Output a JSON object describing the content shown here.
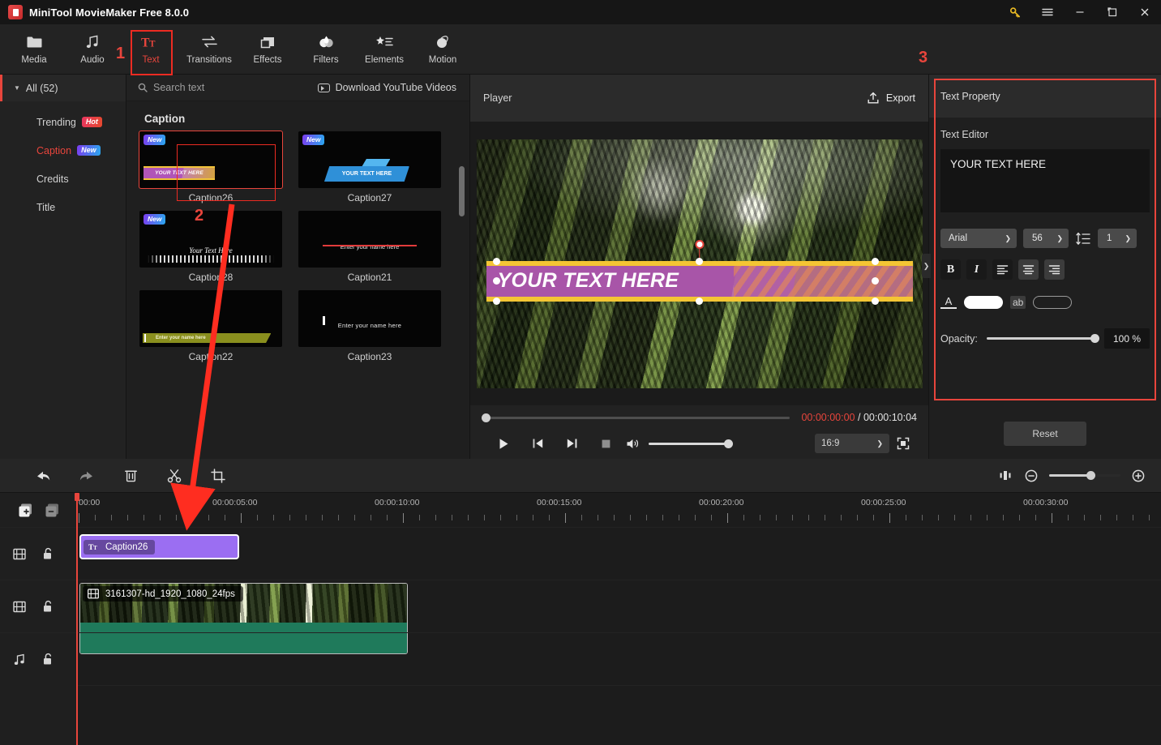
{
  "window": {
    "title": "MiniTool MovieMaker Free 8.0.0",
    "controls": {
      "key": "key-icon",
      "menu": "hamburger-icon",
      "minimize": "–",
      "maximize": "❐",
      "close": "✕"
    }
  },
  "toolbar": {
    "tabs": [
      {
        "label": "Media",
        "icon": "folder-icon",
        "active": false
      },
      {
        "label": "Audio",
        "icon": "music-note-icon",
        "active": false
      },
      {
        "label": "Text",
        "icon": "text-tt-icon",
        "active": true
      },
      {
        "label": "Transitions",
        "icon": "transitions-arrows-icon",
        "active": false
      },
      {
        "label": "Effects",
        "icon": "effects-squares-icon",
        "active": false
      },
      {
        "label": "Filters",
        "icon": "filters-drop-icon",
        "active": false
      },
      {
        "label": "Elements",
        "icon": "elements-star-icon",
        "active": false
      },
      {
        "label": "Motion",
        "icon": "motion-ball-icon",
        "active": false
      }
    ]
  },
  "sidebar": {
    "all": {
      "label": "All (52)",
      "caret": "▼"
    },
    "items": [
      {
        "label": "Trending",
        "badge": "Hot",
        "badge_type": "hot",
        "selected": false
      },
      {
        "label": "Caption",
        "badge": "New",
        "badge_type": "new",
        "selected": true
      },
      {
        "label": "Credits",
        "badge": "",
        "badge_type": "",
        "selected": false
      },
      {
        "label": "Title",
        "badge": "",
        "badge_type": "",
        "selected": false
      }
    ]
  },
  "browse": {
    "search_placeholder": "Search text",
    "search_value": "",
    "download_label": "Download YouTube Videos",
    "section_title": "Caption",
    "tiles": [
      {
        "label": "Caption26",
        "badge": "New",
        "selected": true,
        "art": "art26",
        "art_text": "YOUR TEXT HERE"
      },
      {
        "label": "Caption27",
        "badge": "New",
        "selected": false,
        "art": "art27",
        "art_text": "YOUR TEXT HERE"
      },
      {
        "label": "Caption28",
        "badge": "New",
        "selected": false,
        "art": "art28",
        "art_text": "Your Text Here"
      },
      {
        "label": "Caption21",
        "badge": "",
        "selected": false,
        "art": "art21",
        "art_text": "Enter your name here"
      },
      {
        "label": "Caption22",
        "badge": "",
        "selected": false,
        "art": "art22",
        "art_text": "Enter your name here"
      },
      {
        "label": "Caption23",
        "badge": "",
        "selected": false,
        "art": "art23",
        "art_text": "Enter your name here"
      }
    ]
  },
  "player": {
    "title": "Player",
    "export_label": "Export",
    "overlay_text": "YOUR TEXT HERE",
    "current_time": "00:00:00:00",
    "separator": "/",
    "total_time": "00:00:10:04",
    "aspect_ratio": "16:9",
    "buttons": {
      "play": "▶",
      "prev_frame": "|◀",
      "next_frame": "▶|",
      "stop": "■",
      "volume": "volume-icon",
      "fullscreen": "fullscreen-icon"
    }
  },
  "text_property": {
    "panel_title": "Text Property",
    "editor_label": "Text Editor",
    "editor_value": "YOUR TEXT HERE",
    "font_family": "Arial",
    "font_size": "56",
    "line_height": "1",
    "bold": "B",
    "italic": "I",
    "align_left": "align-left-icon",
    "align_center": "align-center-icon",
    "align_right": "align-right-icon",
    "fill_color": "#ffffff",
    "outline_color": "transparent",
    "opacity_label": "Opacity:",
    "opacity_value": "100 %",
    "reset_label": "Reset"
  },
  "timeline": {
    "tools": [
      {
        "name": "undo",
        "icon": "undo-arrow-icon",
        "dim": false
      },
      {
        "name": "redo",
        "icon": "redo-arrow-icon",
        "dim": true
      },
      {
        "name": "delete",
        "icon": "trash-icon",
        "dim": false
      },
      {
        "name": "split",
        "icon": "scissors-icon",
        "dim": false
      },
      {
        "name": "crop",
        "icon": "crop-icon",
        "dim": false
      }
    ],
    "zoom_icons": {
      "fit": "fit-icon",
      "minus": "−",
      "plus": "+"
    },
    "ruler_labels": [
      "00:00",
      "00:00:05:00",
      "00:00:10:00",
      "00:00:15:00",
      "00:00:20:00",
      "00:00:25:00",
      "00:00:30:00"
    ],
    "track_headers": [
      {
        "add": "add-track-icon",
        "remove": "remove-track-icon"
      },
      {
        "type": "video",
        "icon": "film-icon",
        "lock": "unlock-icon"
      },
      {
        "type": "video",
        "icon": "film-icon",
        "lock": "unlock-icon"
      },
      {
        "type": "audio",
        "icon": "music-icon",
        "lock": "unlock-icon"
      }
    ],
    "clips": [
      {
        "name": "Caption26",
        "type": "text",
        "color": "#9b6ef2"
      },
      {
        "name": "3161307-hd_1920_1080_24fps",
        "type": "video",
        "color": "#1f7a5b"
      }
    ]
  },
  "annotations": {
    "markers": [
      {
        "number": "1",
        "target": "text-tab"
      },
      {
        "number": "2",
        "target": "caption26-tile"
      },
      {
        "number": "3",
        "target": "text-property-panel"
      }
    ],
    "accent_color": "#e8453c"
  }
}
